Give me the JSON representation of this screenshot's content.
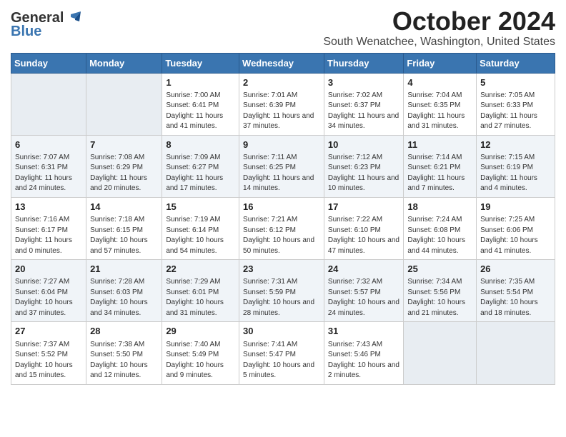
{
  "header": {
    "logo_general": "General",
    "logo_blue": "Blue",
    "month_title": "October 2024",
    "location": "South Wenatchee, Washington, United States"
  },
  "weekdays": [
    "Sunday",
    "Monday",
    "Tuesday",
    "Wednesday",
    "Thursday",
    "Friday",
    "Saturday"
  ],
  "weeks": [
    [
      {
        "day": "",
        "empty": true
      },
      {
        "day": "",
        "empty": true
      },
      {
        "day": "1",
        "sunrise": "7:00 AM",
        "sunset": "6:41 PM",
        "daylight": "11 hours and 41 minutes."
      },
      {
        "day": "2",
        "sunrise": "7:01 AM",
        "sunset": "6:39 PM",
        "daylight": "11 hours and 37 minutes."
      },
      {
        "day": "3",
        "sunrise": "7:02 AM",
        "sunset": "6:37 PM",
        "daylight": "11 hours and 34 minutes."
      },
      {
        "day": "4",
        "sunrise": "7:04 AM",
        "sunset": "6:35 PM",
        "daylight": "11 hours and 31 minutes."
      },
      {
        "day": "5",
        "sunrise": "7:05 AM",
        "sunset": "6:33 PM",
        "daylight": "11 hours and 27 minutes."
      }
    ],
    [
      {
        "day": "6",
        "sunrise": "7:07 AM",
        "sunset": "6:31 PM",
        "daylight": "11 hours and 24 minutes."
      },
      {
        "day": "7",
        "sunrise": "7:08 AM",
        "sunset": "6:29 PM",
        "daylight": "11 hours and 20 minutes."
      },
      {
        "day": "8",
        "sunrise": "7:09 AM",
        "sunset": "6:27 PM",
        "daylight": "11 hours and 17 minutes."
      },
      {
        "day": "9",
        "sunrise": "7:11 AM",
        "sunset": "6:25 PM",
        "daylight": "11 hours and 14 minutes."
      },
      {
        "day": "10",
        "sunrise": "7:12 AM",
        "sunset": "6:23 PM",
        "daylight": "11 hours and 10 minutes."
      },
      {
        "day": "11",
        "sunrise": "7:14 AM",
        "sunset": "6:21 PM",
        "daylight": "11 hours and 7 minutes."
      },
      {
        "day": "12",
        "sunrise": "7:15 AM",
        "sunset": "6:19 PM",
        "daylight": "11 hours and 4 minutes."
      }
    ],
    [
      {
        "day": "13",
        "sunrise": "7:16 AM",
        "sunset": "6:17 PM",
        "daylight": "11 hours and 0 minutes."
      },
      {
        "day": "14",
        "sunrise": "7:18 AM",
        "sunset": "6:15 PM",
        "daylight": "10 hours and 57 minutes."
      },
      {
        "day": "15",
        "sunrise": "7:19 AM",
        "sunset": "6:14 PM",
        "daylight": "10 hours and 54 minutes."
      },
      {
        "day": "16",
        "sunrise": "7:21 AM",
        "sunset": "6:12 PM",
        "daylight": "10 hours and 50 minutes."
      },
      {
        "day": "17",
        "sunrise": "7:22 AM",
        "sunset": "6:10 PM",
        "daylight": "10 hours and 47 minutes."
      },
      {
        "day": "18",
        "sunrise": "7:24 AM",
        "sunset": "6:08 PM",
        "daylight": "10 hours and 44 minutes."
      },
      {
        "day": "19",
        "sunrise": "7:25 AM",
        "sunset": "6:06 PM",
        "daylight": "10 hours and 41 minutes."
      }
    ],
    [
      {
        "day": "20",
        "sunrise": "7:27 AM",
        "sunset": "6:04 PM",
        "daylight": "10 hours and 37 minutes."
      },
      {
        "day": "21",
        "sunrise": "7:28 AM",
        "sunset": "6:03 PM",
        "daylight": "10 hours and 34 minutes."
      },
      {
        "day": "22",
        "sunrise": "7:29 AM",
        "sunset": "6:01 PM",
        "daylight": "10 hours and 31 minutes."
      },
      {
        "day": "23",
        "sunrise": "7:31 AM",
        "sunset": "5:59 PM",
        "daylight": "10 hours and 28 minutes."
      },
      {
        "day": "24",
        "sunrise": "7:32 AM",
        "sunset": "5:57 PM",
        "daylight": "10 hours and 24 minutes."
      },
      {
        "day": "25",
        "sunrise": "7:34 AM",
        "sunset": "5:56 PM",
        "daylight": "10 hours and 21 minutes."
      },
      {
        "day": "26",
        "sunrise": "7:35 AM",
        "sunset": "5:54 PM",
        "daylight": "10 hours and 18 minutes."
      }
    ],
    [
      {
        "day": "27",
        "sunrise": "7:37 AM",
        "sunset": "5:52 PM",
        "daylight": "10 hours and 15 minutes."
      },
      {
        "day": "28",
        "sunrise": "7:38 AM",
        "sunset": "5:50 PM",
        "daylight": "10 hours and 12 minutes."
      },
      {
        "day": "29",
        "sunrise": "7:40 AM",
        "sunset": "5:49 PM",
        "daylight": "10 hours and 9 minutes."
      },
      {
        "day": "30",
        "sunrise": "7:41 AM",
        "sunset": "5:47 PM",
        "daylight": "10 hours and 5 minutes."
      },
      {
        "day": "31",
        "sunrise": "7:43 AM",
        "sunset": "5:46 PM",
        "daylight": "10 hours and 2 minutes."
      },
      {
        "day": "",
        "empty": true
      },
      {
        "day": "",
        "empty": true
      }
    ]
  ],
  "labels": {
    "sunrise_prefix": "Sunrise: ",
    "sunset_prefix": "Sunset: ",
    "daylight_prefix": "Daylight: "
  }
}
